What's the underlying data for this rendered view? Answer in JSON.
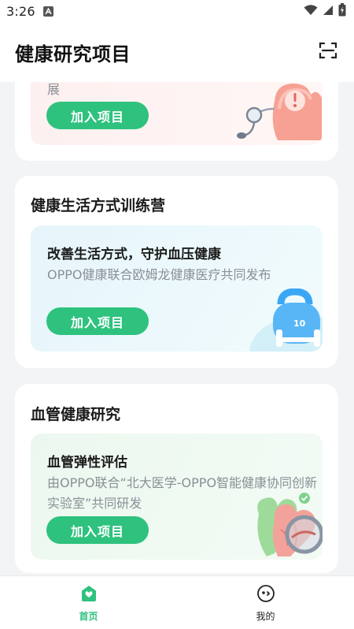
{
  "status_bar": {
    "time": "3:26"
  },
  "header": {
    "title": "健康研究项目",
    "scan_icon": "scan-icon"
  },
  "cards": [
    {
      "panel_desc_tail": "展",
      "button": "加入项目",
      "panel_bg": "#fdf1f1",
      "illustration": "heart-stethoscope-icon"
    },
    {
      "title": "健康生活方式训练营",
      "panel_title": "改善生活方式，守护血压健康",
      "panel_desc": "OPPO健康联合欧姆龙健康医疗共同发布",
      "button": "加入项目",
      "panel_bg": "#e9f7fb",
      "illustration": "kettlebell-dumbbell-icon"
    },
    {
      "title": "血管健康研究",
      "panel_title": "血管弹性评估",
      "panel_desc": "由OPPO联合“北大医学-OPPO智能健康协同创新实验室”共同研发",
      "button": "加入项目",
      "panel_bg": "#eef9f1",
      "illustration": "heart-vessel-magnifier-icon"
    }
  ],
  "bottom_nav": {
    "items": [
      {
        "label": "首页",
        "icon": "home-heart-icon",
        "active": true
      },
      {
        "label": "我的",
        "icon": "profile-face-icon",
        "active": false
      }
    ]
  },
  "colors": {
    "accent": "#2ec27e",
    "background": "#f3f4f5"
  }
}
